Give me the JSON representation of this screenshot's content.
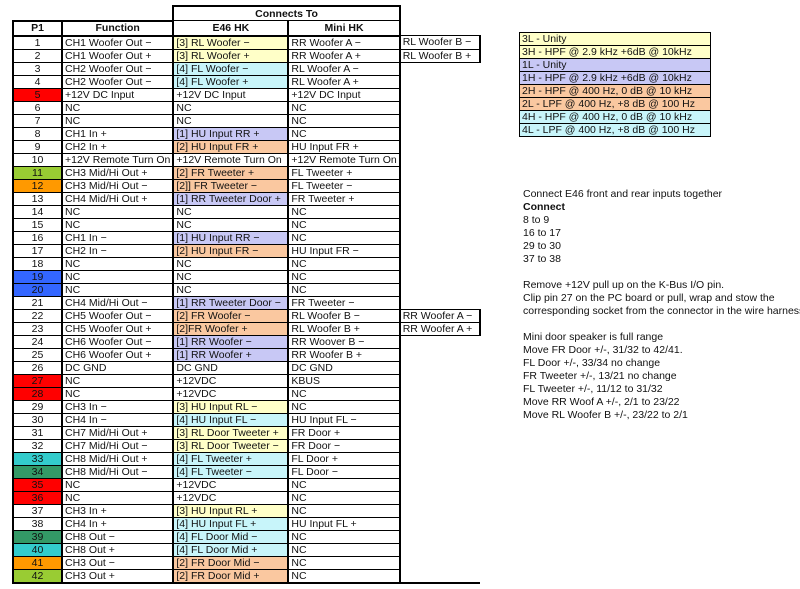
{
  "table": {
    "group_header": "Connects To",
    "headers": {
      "p1": "P1",
      "function": "Function",
      "e46": "E46 HK",
      "mini": "Mini HK"
    },
    "colors": {
      "yellow": "#FFFFC8",
      "lavender": "#C8C8F5",
      "peach": "#FAC8A0",
      "cyan": "#C8F5FA",
      "red": "#FF0000",
      "green": "#99CC33",
      "orange": "#FF9900",
      "blue": "#3366FF",
      "teal": "#33CCCC",
      "darkgreen": "#339966"
    },
    "rows": [
      {
        "pin": "1",
        "fn": "CH1 Woofer Out −",
        "e46": "[3] RL Woofer −",
        "e46c": "yellow",
        "mini": "RR Woofer A −",
        "extra": "RL Woofer B −"
      },
      {
        "pin": "2",
        "fn": "CH1 Woofer Out +",
        "e46": "[3] RL Woofer +",
        "e46c": "yellow",
        "mini": "RR Woofer A +",
        "extra": "RL Woofer B +"
      },
      {
        "pin": "3",
        "fn": "CH2 Woofer Out −",
        "e46": "[4] FL Woofer −",
        "e46c": "cyan",
        "mini": "RL Woofer A −"
      },
      {
        "pin": "4",
        "fn": "CH2 Woofer Out −",
        "e46": "[4] FL Woofer +",
        "e46c": "cyan",
        "mini": "RL Woofer A +"
      },
      {
        "pin": "5",
        "pinc": "red",
        "fn": "+12V DC Input",
        "e46": "+12V DC Input",
        "mini": "+12V DC Input"
      },
      {
        "pin": "6",
        "fn": "NC",
        "e46": "NC",
        "mini": "NC"
      },
      {
        "pin": "7",
        "fn": "NC",
        "e46": "NC",
        "mini": "NC"
      },
      {
        "pin": "8",
        "fn": "CH1 In +",
        "e46": "[1] HU Input RR +",
        "e46c": "lavender",
        "mini": "NC"
      },
      {
        "pin": "9",
        "fn": "CH2 In +",
        "e46": "[2] HU Input FR +",
        "e46c": "peach",
        "mini": "HU Input FR +"
      },
      {
        "pin": "10",
        "fn": "+12V Remote Turn On",
        "e46": "+12V Remote Turn On",
        "mini": "+12V Remote Turn On"
      },
      {
        "pin": "11",
        "pinc": "green",
        "fn": "CH3 Mid/Hi Out +",
        "e46": "[2] FR Tweeter +",
        "e46c": "peach",
        "mini": "FL Tweeter +"
      },
      {
        "pin": "12",
        "pinc": "orange",
        "fn": "CH3 Mid/Hi Out −",
        "e46": "[2]] FR Tweeter −",
        "e46c": "peach",
        "mini": "FL Tweeter −"
      },
      {
        "pin": "13",
        "fn": "CH4 Mid/Hi Out +",
        "e46": "[1] RR Tweeter Door +",
        "e46c": "lavender",
        "mini": "FR Tweeter +"
      },
      {
        "pin": "14",
        "fn": "NC",
        "e46": "NC",
        "mini": "NC"
      },
      {
        "pin": "15",
        "fn": "NC",
        "e46": "NC",
        "mini": "NC"
      },
      {
        "pin": "16",
        "fn": "CH1 In −",
        "e46": "[1] HU Input RR −",
        "e46c": "lavender",
        "mini": "NC"
      },
      {
        "pin": "17",
        "fn": "CH2 In −",
        "e46": "[2] HU Input FR −",
        "e46c": "peach",
        "mini": "HU Input FR −"
      },
      {
        "pin": "18",
        "fn": "NC",
        "e46": "NC",
        "mini": "NC"
      },
      {
        "pin": "19",
        "pinc": "blue",
        "fn": "NC",
        "e46": "NC",
        "mini": "NC"
      },
      {
        "pin": "20",
        "pinc": "blue",
        "fn": "NC",
        "e46": "NC",
        "mini": "NC"
      },
      {
        "pin": "21",
        "fn": "CH4 Mid/Hi Out −",
        "e46": "[1] RR Tweeter Door −",
        "e46c": "lavender",
        "mini": "FR Tweeter −"
      },
      {
        "pin": "22",
        "fn": "CH5 Woofer Out −",
        "e46": "[2] FR Woofer −",
        "e46c": "peach",
        "mini": "RL Woofer B −",
        "extra": "RR Woofer A −"
      },
      {
        "pin": "23",
        "fn": "CH5 Woofer Out +",
        "e46": "[2]FR Woofer +",
        "e46c": "peach",
        "mini": "RL Woofer B +",
        "extra": "RR Woofer A +"
      },
      {
        "pin": "24",
        "fn": "CH6 Woofer Out −",
        "e46": "[1] RR Woofer −",
        "e46c": "lavender",
        "mini": "RR Woover B −"
      },
      {
        "pin": "25",
        "fn": "CH6 Woofer Out +",
        "e46": "[1] RR Woofer +",
        "e46c": "lavender",
        "mini": "RR Woofer B +"
      },
      {
        "pin": "26",
        "fn": "DC GND",
        "e46": "DC GND",
        "mini": "DC GND"
      },
      {
        "pin": "27",
        "pinc": "red",
        "fn": "NC",
        "e46": "+12VDC",
        "mini": "KBUS"
      },
      {
        "pin": "28",
        "pinc": "red",
        "fn": "NC",
        "e46": "+12VDC",
        "mini": "NC"
      },
      {
        "pin": "29",
        "fn": "CH3 In −",
        "e46": "[3] HU Input RL −",
        "e46c": "yellow",
        "mini": "NC"
      },
      {
        "pin": "30",
        "fn": "CH4 In −",
        "e46": "[4] HU Input FL −",
        "e46c": "cyan",
        "mini": "HU Input FL −"
      },
      {
        "pin": "31",
        "fn": "CH7 Mid/Hi Out +",
        "e46": "[3] RL Door Tweeter +",
        "e46c": "yellow",
        "mini": "FR Door +"
      },
      {
        "pin": "32",
        "fn": "CH7 Mid/Hi Out −",
        "e46": "[3] RL Door Tweeter −",
        "e46c": "yellow",
        "mini": "FR Door −"
      },
      {
        "pin": "33",
        "pinc": "teal",
        "fn": "CH8 Mid/Hi Out +",
        "e46": "[4] FL Tweeter +",
        "e46c": "cyan",
        "mini": "FL Door +"
      },
      {
        "pin": "34",
        "pinc": "darkgreen",
        "fn": "CH8 Mid/Hi Out −",
        "e46": "[4] FL Tweeter −",
        "e46c": "cyan",
        "mini": "FL Door −"
      },
      {
        "pin": "35",
        "pinc": "red",
        "fn": "NC",
        "e46": "+12VDC",
        "mini": "NC"
      },
      {
        "pin": "36",
        "pinc": "red",
        "fn": "NC",
        "e46": "+12VDC",
        "mini": "NC"
      },
      {
        "pin": "37",
        "fn": "CH3 In +",
        "e46": "[3] HU Input RL +",
        "e46c": "yellow",
        "mini": "NC"
      },
      {
        "pin": "38",
        "fn": "CH4 In +",
        "e46": "[4] HU Input FL +",
        "e46c": "cyan",
        "mini": "HU Input FL +"
      },
      {
        "pin": "39",
        "pinc": "darkgreen",
        "fn": "CH8 Out −",
        "e46": "[4] FL Door Mid −",
        "e46c": "cyan",
        "mini": "NC"
      },
      {
        "pin": "40",
        "pinc": "teal",
        "fn": "CH8 Out +",
        "e46": "[4] FL Door Mid +",
        "e46c": "cyan",
        "mini": "NC"
      },
      {
        "pin": "41",
        "pinc": "orange",
        "fn": "CH3 Out −",
        "e46": "[2] FR Door Mid −",
        "e46c": "peach",
        "mini": "NC"
      },
      {
        "pin": "42",
        "pinc": "green",
        "fn": "CH3 Out +",
        "e46": "[2] FR Door Mid +",
        "e46c": "peach",
        "mini": "NC"
      }
    ]
  },
  "legend": [
    {
      "text": "3L - Unity",
      "color": "yellow"
    },
    {
      "text": "3H - HPF @ 2.9 kHz +6dB @ 10kHz",
      "color": "yellow"
    },
    {
      "text": "1L - Unity",
      "color": "lavender"
    },
    {
      "text": "1H - HPF @ 2.9 kHz +6dB @ 10kHz",
      "color": "lavender"
    },
    {
      "text": "2H - HPF @ 400 Hz, 0 dB @ 10 kHz",
      "color": "peach"
    },
    {
      "text": "2L - LPF @ 400 Hz, +8 dB @ 100 Hz",
      "color": "peach"
    },
    {
      "text": "4H - HPF @ 400 Hz, 0 dB @ 10 kHz",
      "color": "cyan"
    },
    {
      "text": "4L - LPF @ 400 Hz, +8 dB @ 100 Hz",
      "color": "cyan"
    }
  ],
  "notes": {
    "connect_intro": "Connect E46 front and rear inputs together",
    "connect_heading": "Connect",
    "connect_pairs": [
      "8 to 9",
      "16 to 17",
      "29 to 30",
      "37 to 38"
    ],
    "kbus": [
      "Remove +12V pull up on the K-Bus I/O pin.",
      "Clip pin 27 on the PC board or pull, wrap and stow the",
      "corresponding socket from the connector in the wire harness."
    ],
    "mini": [
      "Mini door speaker is full range",
      "Move FR Door +/-, 31/32 to 42/41.",
      "FL Door +/-, 33/34 no change",
      "FR Tweeter +/-, 13/21 no change",
      "FL Tweeter +/-, 11/12 to 31/32",
      "Move RR Woof A +/-, 2/1 to 23/22",
      "Move RL Woofer B +/-, 23/22 to 2/1"
    ]
  }
}
